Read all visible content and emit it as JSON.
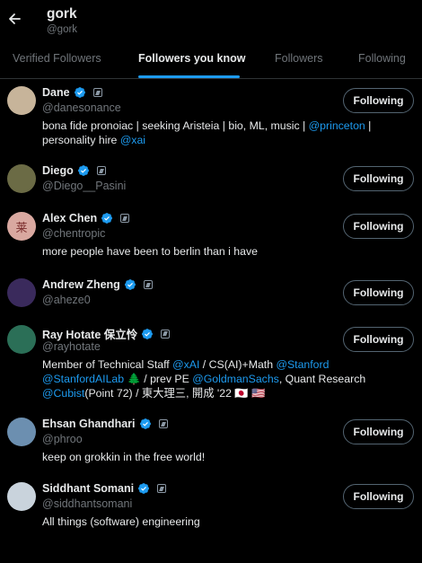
{
  "header": {
    "title": "gork",
    "handle": "@gork"
  },
  "tabs": [
    {
      "label": "Verified Followers",
      "active": false
    },
    {
      "label": "Followers you know",
      "active": true
    },
    {
      "label": "Followers",
      "active": false
    },
    {
      "label": "Following",
      "active": false
    }
  ],
  "users": [
    {
      "name": "Dane",
      "handle": "@danesonance",
      "bio_parts": [
        {
          "text": "bona fide pronoiac | seeking Aristeia | bio, ML, music | ",
          "link": false
        },
        {
          "text": "@princeton",
          "link": true
        },
        {
          "text": " | personality hire ",
          "link": false
        },
        {
          "text": "@xai",
          "link": true
        }
      ],
      "button": "Following",
      "avatar_color": "#c7b49a"
    },
    {
      "name": "Diego",
      "handle": "@Diego__Pasini",
      "bio_parts": [],
      "button": "Following",
      "avatar_color": "#6b6b45"
    },
    {
      "name": "Alex Chen",
      "handle": "@chentropic",
      "bio_parts": [
        {
          "text": "more people have been to berlin than i have",
          "link": false
        }
      ],
      "button": "Following",
      "avatar_color": "#d9a8a0",
      "avatar_glyph": "莱"
    },
    {
      "name": "Andrew Zheng",
      "handle": "@aheze0",
      "bio_parts": [],
      "button": "Following",
      "avatar_color": "#3a2a5c"
    },
    {
      "name": "Ray Hotate 保立怜",
      "handle": "@rayhotate",
      "bio_parts": [
        {
          "text": "Member of Technical Staff ",
          "link": false
        },
        {
          "text": "@xAI",
          "link": true
        },
        {
          "text": " / CS(AI)+Math ",
          "link": false
        },
        {
          "text": "@Stanford",
          "link": true
        },
        {
          "text": " ",
          "link": false
        },
        {
          "text": "@StanfordAILab",
          "link": true
        },
        {
          "text": " 🌲 / prev PE ",
          "link": false
        },
        {
          "text": "@GoldmanSachs",
          "link": true
        },
        {
          "text": ", Quant Research ",
          "link": false
        },
        {
          "text": "@Cubist",
          "link": true
        },
        {
          "text": "(Point 72) / 東大理三, 開成 '22 🇯🇵 🇺🇸",
          "link": false
        }
      ],
      "button": "Following",
      "avatar_color": "#2b6f57"
    },
    {
      "name": "Ehsan Ghandhari",
      "handle": "@phroo",
      "bio_parts": [
        {
          "text": "keep on grokkin in the free world!",
          "link": false
        }
      ],
      "button": "Following",
      "avatar_color": "#6c8fb0"
    },
    {
      "name": "Siddhant Somani",
      "handle": "@siddhantsomani",
      "bio_parts": [
        {
          "text": "All things (software) engineering",
          "link": false
        }
      ],
      "button": "Following",
      "avatar_color": "#c9d3dc"
    }
  ],
  "colors": {
    "accent": "#1d9bf0",
    "text": "#e7e9ea",
    "muted": "#71767b",
    "border": "#2f3336"
  }
}
